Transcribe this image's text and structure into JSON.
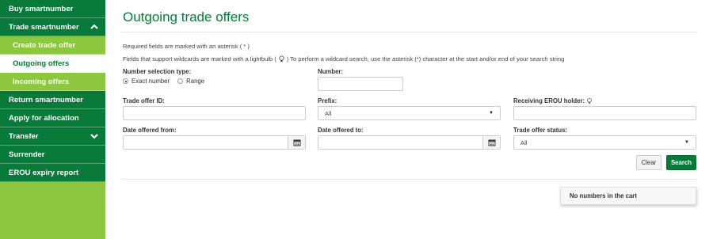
{
  "sidebar": {
    "items": [
      {
        "label": "Buy smartnumber",
        "style": "main"
      },
      {
        "label": "Trade smartnumber",
        "style": "main",
        "chevron": "up"
      },
      {
        "label": "Create trade offer",
        "style": "sub"
      },
      {
        "label": "Outgoing offers",
        "style": "sub-active"
      },
      {
        "label": "Incoming offers",
        "style": "sub"
      },
      {
        "label": "Return smartnumber",
        "style": "main"
      },
      {
        "label": "Apply for allocation",
        "style": "main"
      },
      {
        "label": "Transfer",
        "style": "main",
        "chevron": "down"
      },
      {
        "label": "Surrender",
        "style": "main"
      },
      {
        "label": "EROU expiry report",
        "style": "main"
      }
    ]
  },
  "page": {
    "title": "Outgoing trade offers",
    "required_note": "Required fields are marked with an asterisk ( * )",
    "wildcard_note_before": "Fields that support wildcards are marked with a lightbulb (",
    "wildcard_note_after": ") To perform a wildcard search, use the asterisk (*) character at the start and/or end of your search string"
  },
  "form": {
    "number_selection_label": "Number selection type:",
    "exact_label": "Exact number",
    "range_label": "Range",
    "selected_type": "exact",
    "number_label": "Number:",
    "number_value": "",
    "trade_offer_id_label": "Trade offer ID:",
    "trade_offer_id_value": "",
    "prefix_label": "Prefix:",
    "prefix_value": "All",
    "receiving_label": "Receiving EROU holder:",
    "receiving_value": "",
    "date_from_label": "Date offered from:",
    "date_from_value": "",
    "date_to_label": "Date offered to:",
    "date_to_value": "",
    "status_label": "Trade offer status:",
    "status_value": "All",
    "clear_label": "Clear",
    "search_label": "Search"
  },
  "cart": {
    "text": "No numbers in the cart"
  },
  "icons": {
    "lightbulb": "lightbulb-icon",
    "calendar": "calendar-icon",
    "chevron_up": "chevron-up-icon",
    "chevron_down": "chevron-down-icon",
    "caret": "caret-down-icon"
  },
  "colors": {
    "primary_green": "#0a7a3a",
    "light_green": "#8dc63f"
  }
}
